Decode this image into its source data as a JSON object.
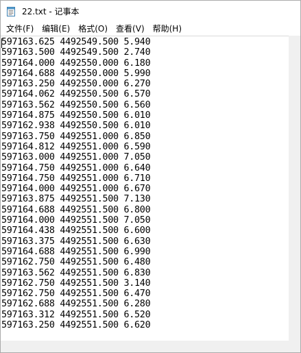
{
  "window": {
    "title": "22.txt - 记事本"
  },
  "menubar": {
    "items": [
      {
        "label": "文件(F)"
      },
      {
        "label": "编辑(E)"
      },
      {
        "label": "格式(O)"
      },
      {
        "label": "查看(V)"
      },
      {
        "label": "帮助(H)"
      }
    ]
  },
  "editor": {
    "lines": [
      "597163.625 4492549.500 5.940",
      "597163.500 4492549.500 2.740",
      "597164.000 4492550.000 6.180",
      "597164.688 4492550.000 5.990",
      "597163.250 4492550.000 6.270",
      "597164.062 4492550.500 6.570",
      "597163.562 4492550.500 6.560",
      "597164.875 4492550.500 6.010",
      "597162.938 4492550.500 6.010",
      "597163.750 4492551.000 6.850",
      "597164.812 4492551.000 6.590",
      "597163.000 4492551.000 7.050",
      "597164.750 4492551.000 6.640",
      "597164.750 4492551.000 6.710",
      "597164.000 4492551.000 6.670",
      "597163.875 4492551.500 7.130",
      "597164.688 4492551.500 6.800",
      "597164.000 4492551.500 7.050",
      "597164.438 4492551.500 6.600",
      "597163.375 4492551.500 6.630",
      "597164.688 4492551.500 6.990",
      "597162.750 4492551.500 6.480",
      "597163.562 4492551.500 6.830",
      "597162.750 4492551.500 3.140",
      "597162.750 4492551.500 6.470",
      "597162.688 4492551.500 6.280",
      "597163.312 4492551.500 6.520",
      "597163.250 4492551.500 6.620"
    ]
  },
  "icons": {
    "app": "notepad-icon"
  }
}
